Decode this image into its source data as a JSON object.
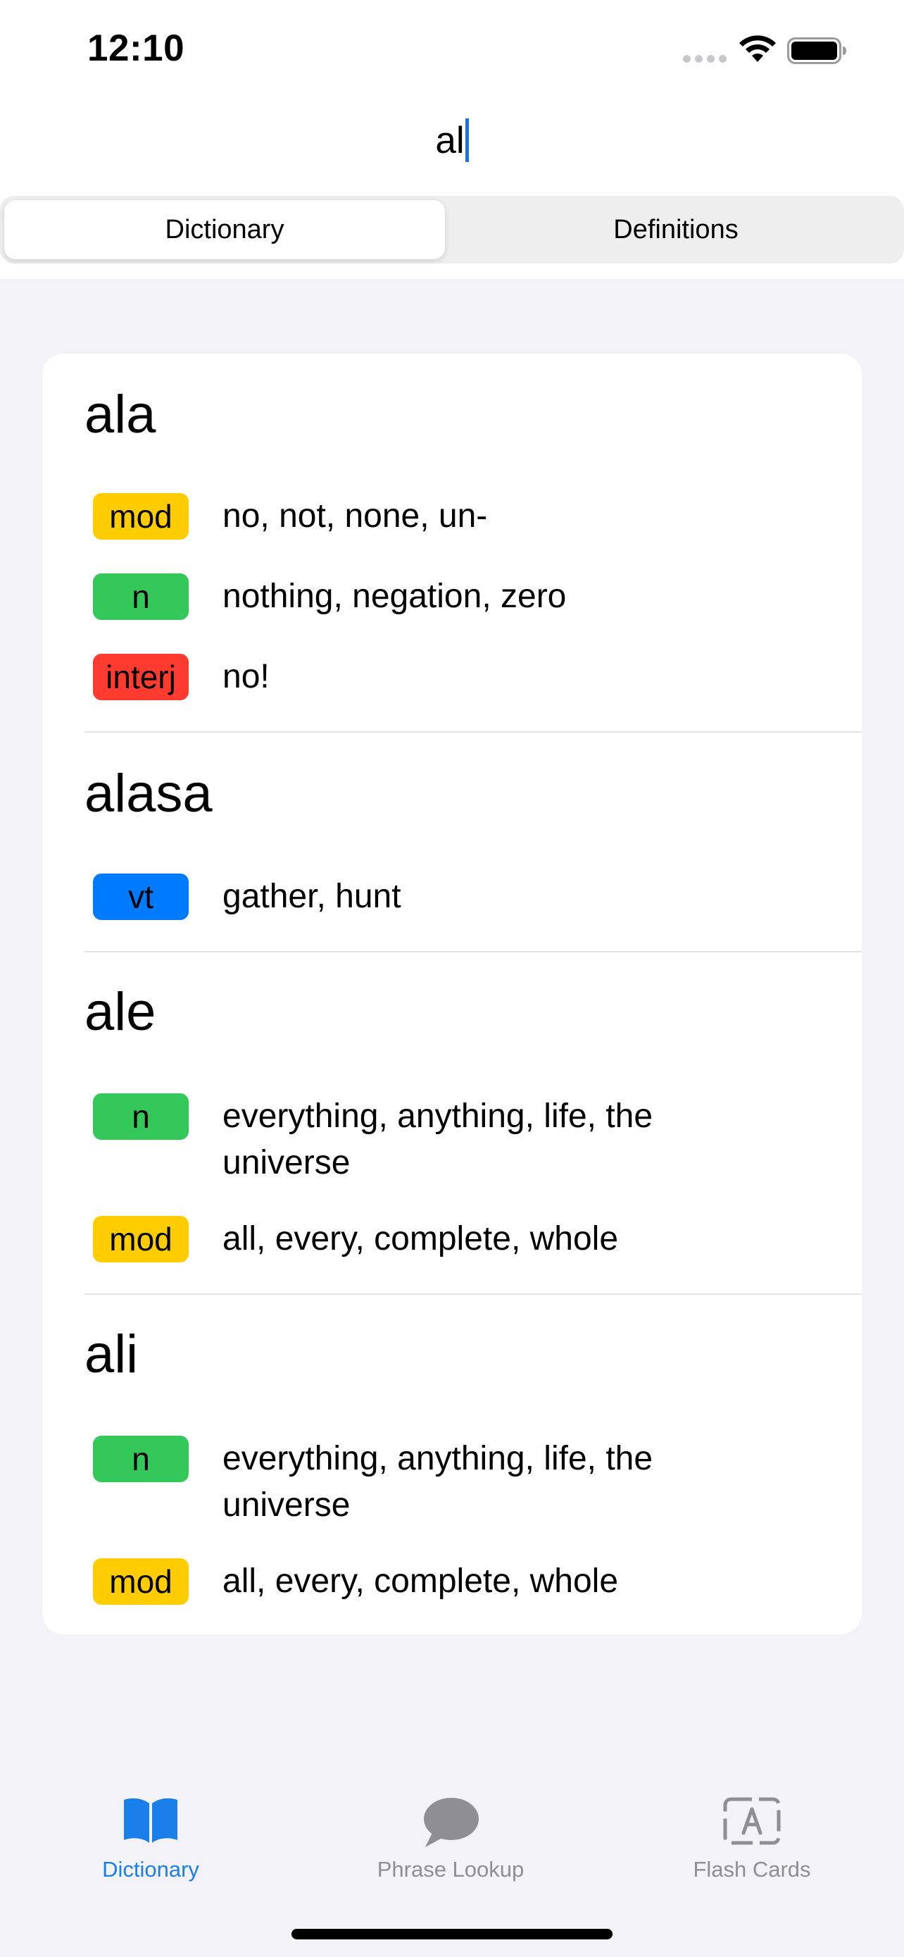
{
  "status_bar": {
    "time": "12:10"
  },
  "search": {
    "value": "al"
  },
  "segments": [
    {
      "label": "Dictionary",
      "selected": true
    },
    {
      "label": "Definitions",
      "selected": false
    }
  ],
  "pos_colors": {
    "mod": "#ffcc00",
    "n": "#34c759",
    "interj": "#ff3b30",
    "vt": "#007aff"
  },
  "entries": [
    {
      "word": "ala",
      "definitions": [
        {
          "pos": "mod",
          "text": "no, not, none, un-"
        },
        {
          "pos": "n",
          "text": "nothing, negation, zero"
        },
        {
          "pos": "interj",
          "text": "no!"
        }
      ]
    },
    {
      "word": "alasa",
      "definitions": [
        {
          "pos": "vt",
          "text": "gather, hunt"
        }
      ]
    },
    {
      "word": "ale",
      "definitions": [
        {
          "pos": "n",
          "text": "everything, anything, life, the universe"
        },
        {
          "pos": "mod",
          "text": "all, every, complete, whole"
        }
      ]
    },
    {
      "word": "ali",
      "definitions": [
        {
          "pos": "n",
          "text": "everything, anything, life, the universe"
        },
        {
          "pos": "mod",
          "text": "all, every, complete, whole"
        }
      ]
    }
  ],
  "tabbar": {
    "active_color": "#1a7fe8",
    "inactive_color": "#8e8e93",
    "tabs": [
      {
        "label": "Dictionary",
        "icon": "book-icon",
        "active": true
      },
      {
        "label": "Phrase Lookup",
        "icon": "speech-bubble-icon",
        "active": false
      },
      {
        "label": "Flash Cards",
        "icon": "flash-card-icon",
        "active": false
      }
    ]
  }
}
